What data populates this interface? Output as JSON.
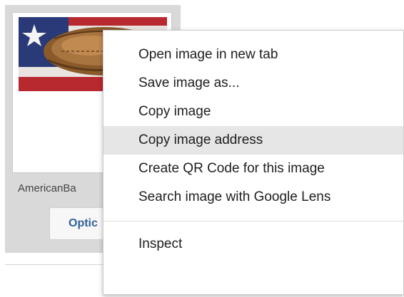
{
  "card": {
    "thumbnail_icon": "baseball-glove-flag-image",
    "filename": "AmericanBa",
    "options_label": "Optic"
  },
  "context_menu": {
    "items": [
      {
        "label": "Open image in new tab"
      },
      {
        "label": "Save image as..."
      },
      {
        "label": "Copy image"
      },
      {
        "label": "Copy image address",
        "hovered": true
      },
      {
        "label": "Create QR Code for this image"
      },
      {
        "label": "Search image with Google Lens"
      }
    ],
    "inspect_label": "Inspect",
    "hover_color": "#e6e6e6"
  }
}
